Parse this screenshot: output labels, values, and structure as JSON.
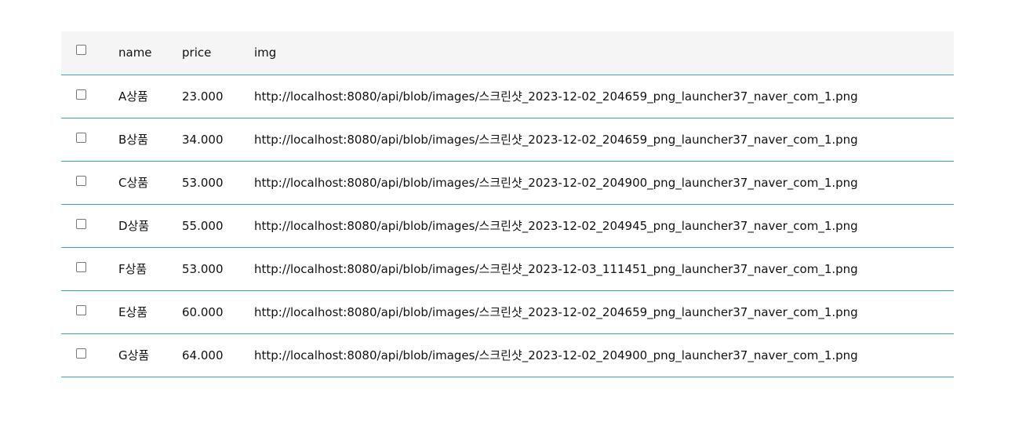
{
  "table": {
    "headers": {
      "name": "name",
      "price": "price",
      "img": "img"
    },
    "rows": [
      {
        "name": "A상품",
        "price": "23.000",
        "img": "http://localhost:8080/api/blob/images/스크린샷_2023-12-02_204659_png_launcher37_naver_com_1.png"
      },
      {
        "name": "B상품",
        "price": "34.000",
        "img": "http://localhost:8080/api/blob/images/스크린샷_2023-12-02_204659_png_launcher37_naver_com_1.png"
      },
      {
        "name": "C상품",
        "price": "53.000",
        "img": "http://localhost:8080/api/blob/images/스크린샷_2023-12-02_204900_png_launcher37_naver_com_1.png"
      },
      {
        "name": "D상품",
        "price": "55.000",
        "img": "http://localhost:8080/api/blob/images/스크린샷_2023-12-02_204945_png_launcher37_naver_com_1.png"
      },
      {
        "name": "F상품",
        "price": "53.000",
        "img": "http://localhost:8080/api/blob/images/스크린샷_2023-12-03_111451_png_launcher37_naver_com_1.png"
      },
      {
        "name": "E상품",
        "price": "60.000",
        "img": "http://localhost:8080/api/blob/images/스크린샷_2023-12-02_204659_png_launcher37_naver_com_1.png"
      },
      {
        "name": "G상품",
        "price": "64.000",
        "img": "http://localhost:8080/api/blob/images/스크린샷_2023-12-02_204900_png_launcher37_naver_com_1.png"
      }
    ]
  },
  "colors": {
    "header_bg": "#f5f5f5",
    "row_divider": "#3aa9ad"
  }
}
